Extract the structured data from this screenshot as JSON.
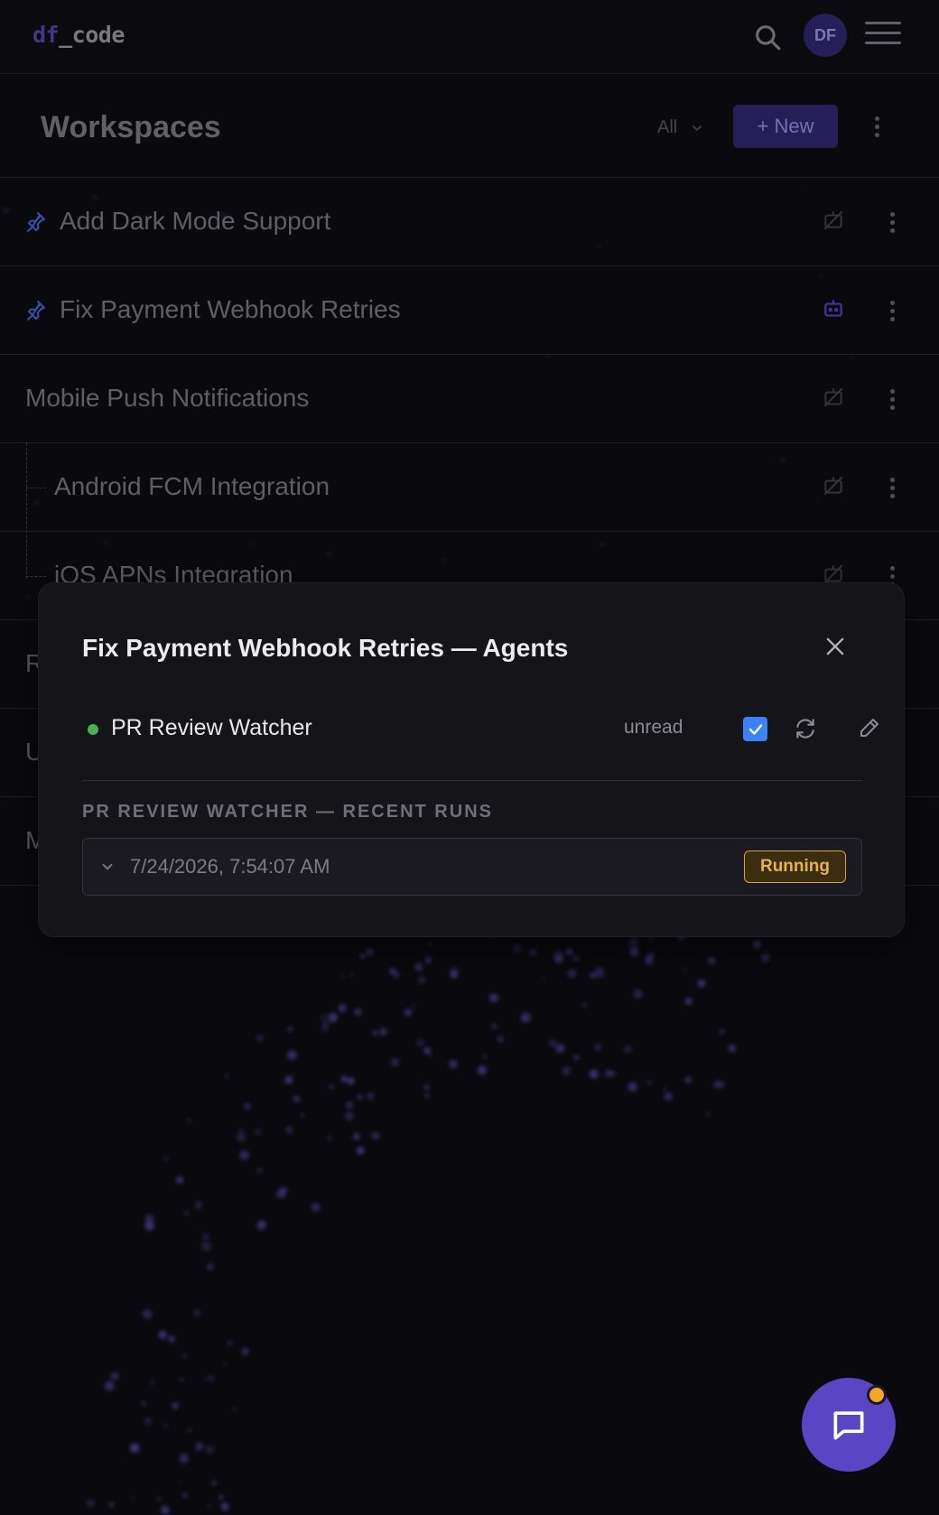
{
  "app": {
    "logo_prefix": "df",
    "logo_suffix": "_code",
    "avatar_initials": "DF"
  },
  "workspaces": {
    "title": "Workspaces",
    "filter_value": "All",
    "new_button_label": "+ New",
    "items": [
      {
        "label": "Add Dark Mode Support",
        "pinned": true,
        "agent_active": false
      },
      {
        "label": "Fix Payment Webhook Retries",
        "pinned": true,
        "agent_active": true
      },
      {
        "label": "Mobile Push Notifications",
        "pinned": false,
        "agent_active": false
      },
      {
        "label": "Android FCM Integration",
        "pinned": false,
        "agent_active": false,
        "child": true
      },
      {
        "label": "iOS APNs Integration",
        "pinned": false,
        "agent_active": false,
        "child": true
      },
      {
        "label": "R",
        "partially_hidden": true
      },
      {
        "label": "U",
        "partially_hidden": true
      },
      {
        "label": "M",
        "partially_hidden": true
      }
    ]
  },
  "modal": {
    "title": "Fix Payment Webhook Retries — Agents",
    "agent": {
      "name": "PR Review Watcher",
      "status": "active",
      "unread_label": "unread",
      "unread_checked": true
    },
    "recent_runs_label": "PR REVIEW WATCHER — RECENT RUNS",
    "runs": [
      {
        "timestamp": "7/24/2026, 7:54:07 AM",
        "status": "Running"
      }
    ]
  },
  "colors": {
    "accent": "#5a45c4",
    "running_badge": "#d4a437",
    "status_ok": "#4caf50",
    "checkbox": "#3b82f6"
  },
  "icons": [
    "search-icon",
    "hamburger-menu-icon",
    "pin-icon",
    "agent-off-icon",
    "agent-bot-icon",
    "kebab-menu-icon",
    "close-icon",
    "refresh-icon",
    "edit-icon",
    "chevron-down-icon",
    "chat-icon"
  ]
}
